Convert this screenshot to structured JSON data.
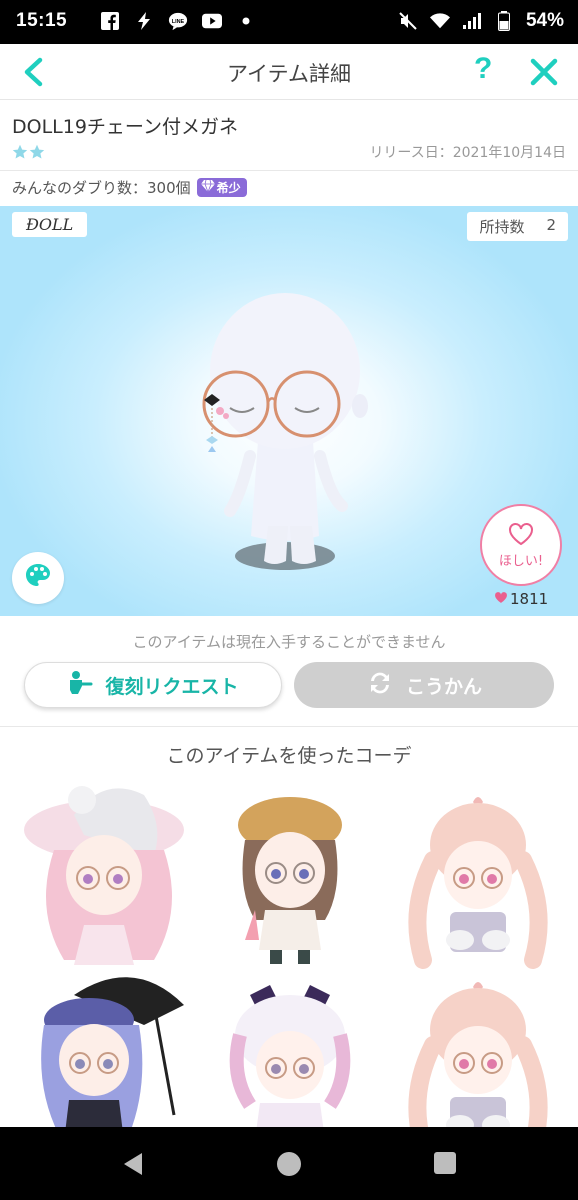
{
  "status_bar": {
    "time": "15:15",
    "battery": "54%",
    "left_icons": [
      "facebook-icon",
      "bolt-icon",
      "line-icon",
      "youtube-icon",
      "dot-icon"
    ],
    "right_icons": [
      "mute-icon",
      "wifi-icon",
      "signal-icon",
      "battery-icon"
    ]
  },
  "header": {
    "title": "アイテム詳細",
    "help_label": "?"
  },
  "item": {
    "name": "DOLL19チェーン付メガネ",
    "stars": 2,
    "release": "リリース日：2021年10月14日",
    "dup_label": "みんなのダブり数：300個",
    "rare_label": "希少"
  },
  "preview": {
    "brand": "ÐOLL",
    "owned_label": "所持数",
    "owned_count": "2",
    "want_label": "ほしい!",
    "want_count": "1811"
  },
  "notice": "このアイテムは現在入手することができません",
  "buttons": {
    "request": "復刻リクエスト",
    "exchange": "こうかん"
  },
  "coord_section_title": "このアイテムを使ったコーデ",
  "colors": {
    "accent": "#1fcfbf",
    "rare": "#8a6bd8",
    "want": "#ea5f8e",
    "disabled": "#cfcfcf"
  }
}
